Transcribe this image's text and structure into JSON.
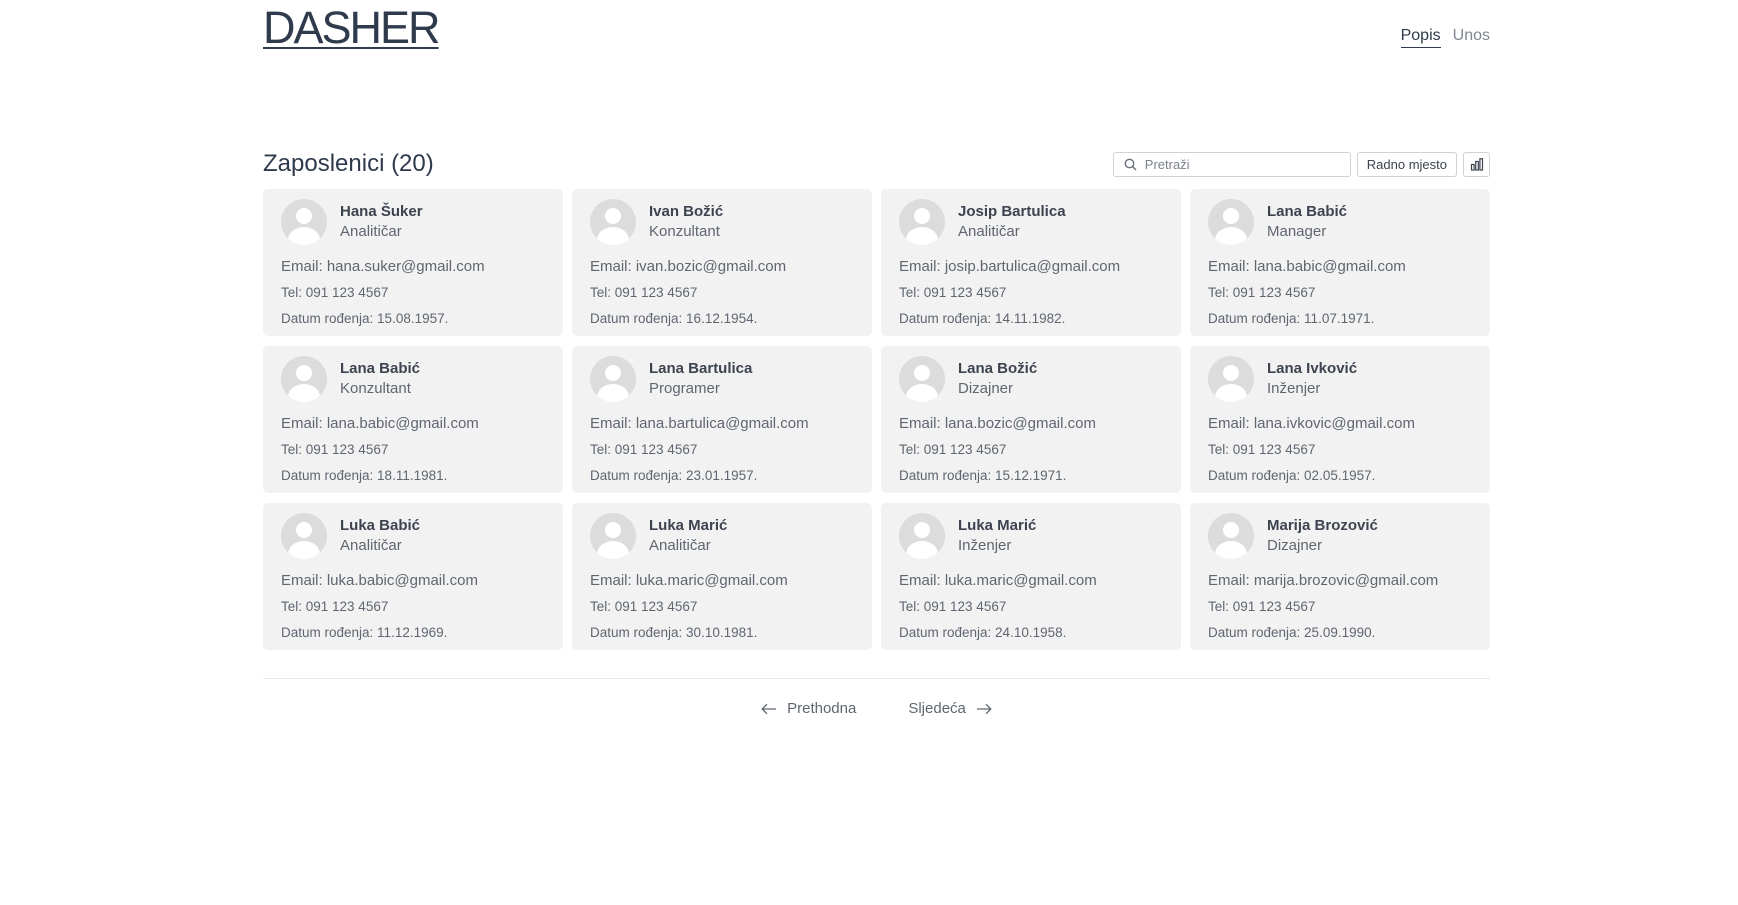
{
  "header": {
    "logo": "DASHER",
    "nav": [
      {
        "label": "Popis",
        "active": true
      },
      {
        "label": "Unos",
        "active": false
      }
    ]
  },
  "list": {
    "title": "Zaposlenici (20)",
    "search_placeholder": "Pretraži",
    "filter_label": "Radno mjesto",
    "chart_icon": "bar-chart-icon"
  },
  "employees": [
    {
      "name": "Hana Šuker",
      "role": "Analitičar",
      "email": "Email: hana.suker@gmail.com",
      "tel": "Tel: 091 123 4567",
      "dob": "Datum rođenja: 15.08.1957."
    },
    {
      "name": "Ivan Božić",
      "role": "Konzultant",
      "email": "Email: ivan.bozic@gmail.com",
      "tel": "Tel: 091 123 4567",
      "dob": "Datum rođenja: 16.12.1954."
    },
    {
      "name": "Josip Bartulica",
      "role": "Analitičar",
      "email": "Email: josip.bartulica@gmail.com",
      "tel": "Tel: 091 123 4567",
      "dob": "Datum rođenja: 14.11.1982."
    },
    {
      "name": "Lana Babić",
      "role": "Manager",
      "email": "Email: lana.babic@gmail.com",
      "tel": "Tel: 091 123 4567",
      "dob": "Datum rođenja: 11.07.1971."
    },
    {
      "name": "Lana Babić",
      "role": "Konzultant",
      "email": "Email: lana.babic@gmail.com",
      "tel": "Tel: 091 123 4567",
      "dob": "Datum rođenja: 18.11.1981."
    },
    {
      "name": "Lana Bartulica",
      "role": "Programer",
      "email": "Email: lana.bartulica@gmail.com",
      "tel": "Tel: 091 123 4567",
      "dob": "Datum rođenja: 23.01.1957."
    },
    {
      "name": "Lana Božić",
      "role": "Dizajner",
      "email": "Email: lana.bozic@gmail.com",
      "tel": "Tel: 091 123 4567",
      "dob": "Datum rođenja: 15.12.1971."
    },
    {
      "name": "Lana Ivković",
      "role": "Inženjer",
      "email": "Email: lana.ivkovic@gmail.com",
      "tel": "Tel: 091 123 4567",
      "dob": "Datum rođenja: 02.05.1957."
    },
    {
      "name": "Luka Babić",
      "role": "Analitičar",
      "email": "Email: luka.babic@gmail.com",
      "tel": "Tel: 091 123 4567",
      "dob": "Datum rođenja: 11.12.1969."
    },
    {
      "name": "Luka Marić",
      "role": "Analitičar",
      "email": "Email: luka.maric@gmail.com",
      "tel": "Tel: 091 123 4567",
      "dob": "Datum rođenja: 30.10.1981."
    },
    {
      "name": "Luka Marić",
      "role": "Inženjer",
      "email": "Email: luka.maric@gmail.com",
      "tel": "Tel: 091 123 4567",
      "dob": "Datum rođenja: 24.10.1958."
    },
    {
      "name": "Marija Brozović",
      "role": "Dizajner",
      "email": "Email: marija.brozovic@gmail.com",
      "tel": "Tel: 091 123 4567",
      "dob": "Datum rođenja: 25.09.1990."
    }
  ],
  "pagination": {
    "prev_label": "Prethodna",
    "next_label": "Sljedeća"
  }
}
